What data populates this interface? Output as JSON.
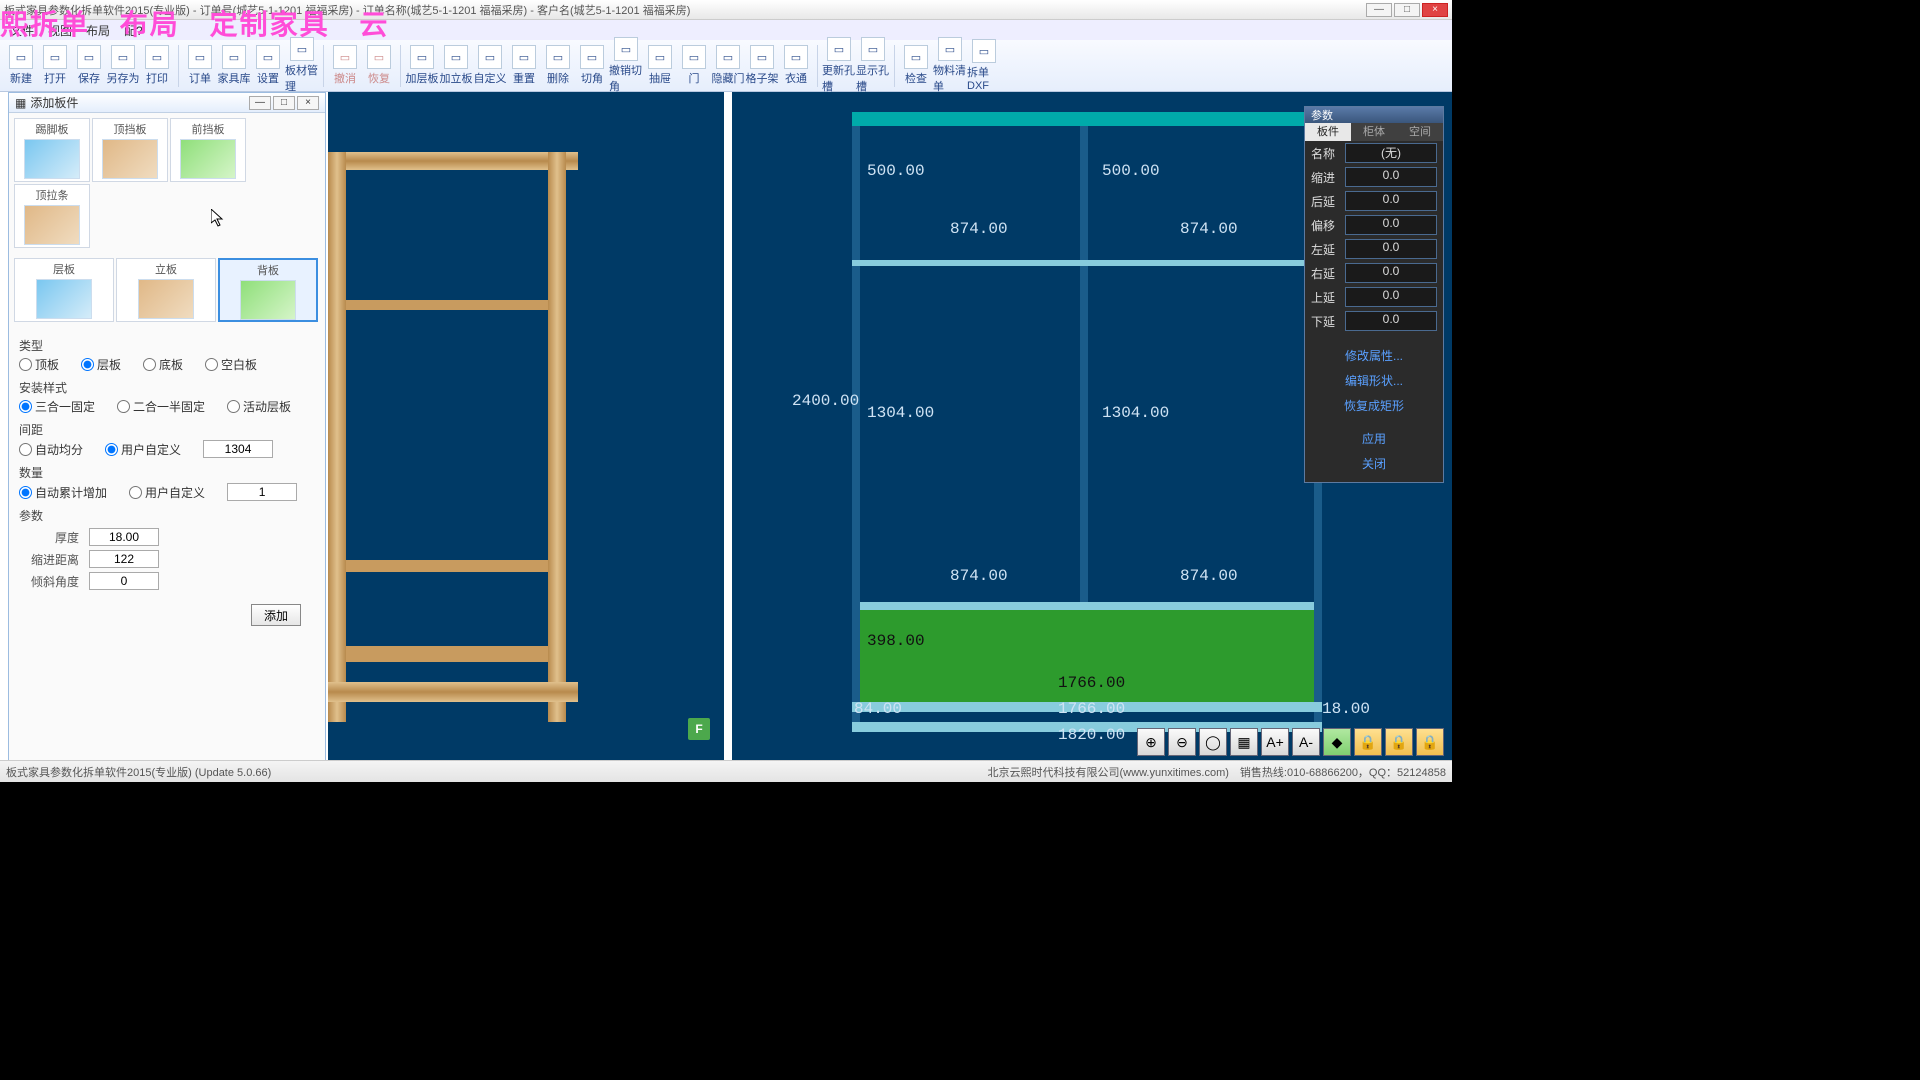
{
  "window": {
    "title": "板式家具参数化拆单软件2015(专业版) - 订单号(城艺5-1-1201 福福采房) - 订单名称(城艺5-1-1201 福福采房) - 客户名(城艺5-1-1201 福福采房)"
  },
  "watermark": {
    "a": "熙拆单",
    "b": "布局",
    "c": "定制家具",
    "d": "云"
  },
  "menu": [
    "文件",
    "视图",
    "布局",
    "配?"
  ],
  "ribbon": [
    {
      "l": "新建"
    },
    {
      "l": "打开"
    },
    {
      "l": "保存"
    },
    {
      "l": "另存为"
    },
    {
      "l": "打印"
    },
    {
      "sep": true
    },
    {
      "l": "订单"
    },
    {
      "l": "家具库"
    },
    {
      "l": "设置"
    },
    {
      "l": "板材管理"
    },
    {
      "sep": true
    },
    {
      "l": "撤消",
      "u": true
    },
    {
      "l": "恢复",
      "u": true
    },
    {
      "sep": true
    },
    {
      "l": "加层板"
    },
    {
      "l": "加立板"
    },
    {
      "l": "自定义"
    },
    {
      "l": "重置"
    },
    {
      "l": "删除"
    },
    {
      "l": "切角"
    },
    {
      "l": "撤销切角"
    },
    {
      "l": "抽屉"
    },
    {
      "l": "门"
    },
    {
      "l": "隐藏门"
    },
    {
      "l": "格子架"
    },
    {
      "l": "衣通"
    },
    {
      "sep": true
    },
    {
      "l": "更新孔槽"
    },
    {
      "l": "显示孔槽"
    },
    {
      "sep": true
    },
    {
      "l": "检查"
    },
    {
      "l": "物料清单"
    },
    {
      "l": "拆单DXF"
    }
  ],
  "panel": {
    "title": "添加板件",
    "thumbs1": [
      {
        "l": "踢脚板",
        "c": "blue"
      },
      {
        "l": "顶挡板",
        "c": "wood"
      },
      {
        "l": "前挡板",
        "c": "green"
      },
      {
        "l": "顶拉条",
        "c": "wood"
      }
    ],
    "thumbs2": [
      {
        "l": "层板",
        "c": "blue",
        "big": true
      },
      {
        "l": "立板",
        "c": "wood",
        "big": true
      },
      {
        "l": "背板",
        "c": "green",
        "big": true,
        "sel": true
      }
    ],
    "sec_type": "类型",
    "type_opts": [
      "顶板",
      "层板",
      "底板",
      "空白板"
    ],
    "type_sel": 1,
    "sec_install": "安装样式",
    "install_opts": [
      "三合一固定",
      "二合一半固定",
      "活动层板"
    ],
    "install_sel": 0,
    "sec_dist": "间距",
    "dist_opts": [
      "自动均分",
      "用户自定义"
    ],
    "dist_sel": 1,
    "dist_val": "1304",
    "sec_qty": "数量",
    "qty_opts": [
      "自动累计增加",
      "用户自定义"
    ],
    "qty_sel": 0,
    "qty_val": "1",
    "sec_param": "参数",
    "p_thick_l": "厚度",
    "p_thick_v": "18.00",
    "p_indent_l": "缩进距离",
    "p_indent_v": "122",
    "p_angle_l": "倾斜角度",
    "p_angle_v": "0",
    "btn_add": "添加"
  },
  "params": {
    "title": "参数",
    "tabs": [
      "板件",
      "柜体",
      "空间"
    ],
    "name_l": "名称",
    "name_v": "(无)",
    "rows": [
      {
        "l": "缩进",
        "v": "0.0"
      },
      {
        "l": "后延",
        "v": "0.0"
      },
      {
        "l": "偏移",
        "v": "0.0"
      },
      {
        "l": "左延",
        "v": "0.0"
      },
      {
        "l": "右延",
        "v": "0.0"
      },
      {
        "l": "上延",
        "v": "0.0"
      },
      {
        "l": "下延",
        "v": "0.0"
      }
    ],
    "links": [
      "修改属性...",
      "编辑形状...",
      "恢复成矩形",
      "应用",
      "关闭"
    ]
  },
  "dims": {
    "h_total": "2400.00",
    "h_top": "500.00",
    "h_mid": "1304.00",
    "h_bot": "398.00",
    "h_kick": "84.00",
    "w1": "874.00",
    "w2": "874.00",
    "w_total": "1820.00",
    "w_inner": "1766.00",
    "r_edge": "18.00"
  },
  "fbadge": "F",
  "status": {
    "left": "板式家具参数化拆单软件2015(专业版) (Update 5.0.66)",
    "right": "北京云熙时代科技有限公司(www.yunxitimes.com)　销售热线:010-68866200，QQ：52124858"
  }
}
